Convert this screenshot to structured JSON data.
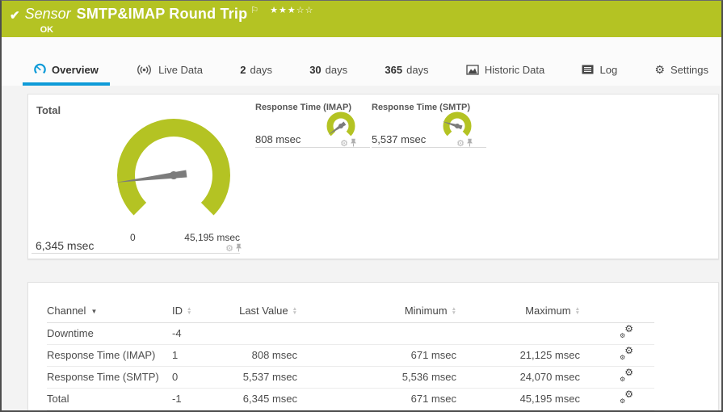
{
  "header": {
    "kind_label": "Sensor",
    "title": "SMTP&IMAP Round Trip",
    "status": "OK",
    "rating_filled": 3,
    "rating_total": 5
  },
  "icons": {
    "check": "✔",
    "flag": "⚐",
    "stars_filled": "★★★",
    "stars_empty": "☆☆",
    "gear": "⚙",
    "sort_desc": "▼",
    "sort_up": "▲",
    "sort_down": "▼"
  },
  "tabs": [
    {
      "label": "Overview",
      "active": true
    },
    {
      "label": "Live Data"
    },
    {
      "num": "2",
      "label": "days"
    },
    {
      "num": "30",
      "label": "days"
    },
    {
      "num": "365",
      "label": "days"
    },
    {
      "label": "Historic Data"
    },
    {
      "label": "Log"
    },
    {
      "label": "Settings"
    }
  ],
  "gauges": {
    "total": {
      "title": "Total",
      "value": 6345,
      "min": 0,
      "max": 45195,
      "value_label": "6,345 msec",
      "min_label": "0",
      "max_label": "45,195 msec"
    },
    "imap": {
      "title": "Response Time (IMAP)",
      "value": 808,
      "min": 0,
      "max": 21125,
      "value_label": "808 msec"
    },
    "smtp": {
      "title": "Response Time (SMTP)",
      "value": 5537,
      "min": 0,
      "max": 24070,
      "value_label": "5,537 msec"
    }
  },
  "table": {
    "columns": [
      "Channel",
      "ID",
      "Last Value",
      "Minimum",
      "Maximum"
    ],
    "rows": [
      {
        "channel": "Downtime",
        "id": "-4",
        "last": "",
        "min": "",
        "max": ""
      },
      {
        "channel": "Response Time (IMAP)",
        "id": "1",
        "last": "808 msec",
        "min": "671 msec",
        "max": "21,125 msec"
      },
      {
        "channel": "Response Time (SMTP)",
        "id": "0",
        "last": "5,537 msec",
        "min": "5,536 msec",
        "max": "24,070 msec"
      },
      {
        "channel": "Total",
        "id": "-1",
        "last": "6,345 msec",
        "min": "671 msec",
        "max": "45,195 msec"
      }
    ]
  },
  "colors": {
    "brand_green": "#b4c323",
    "accent_blue": "#0e9bd8",
    "gauge_green": "#b4c323",
    "needle_gray": "#7c7c7c"
  }
}
